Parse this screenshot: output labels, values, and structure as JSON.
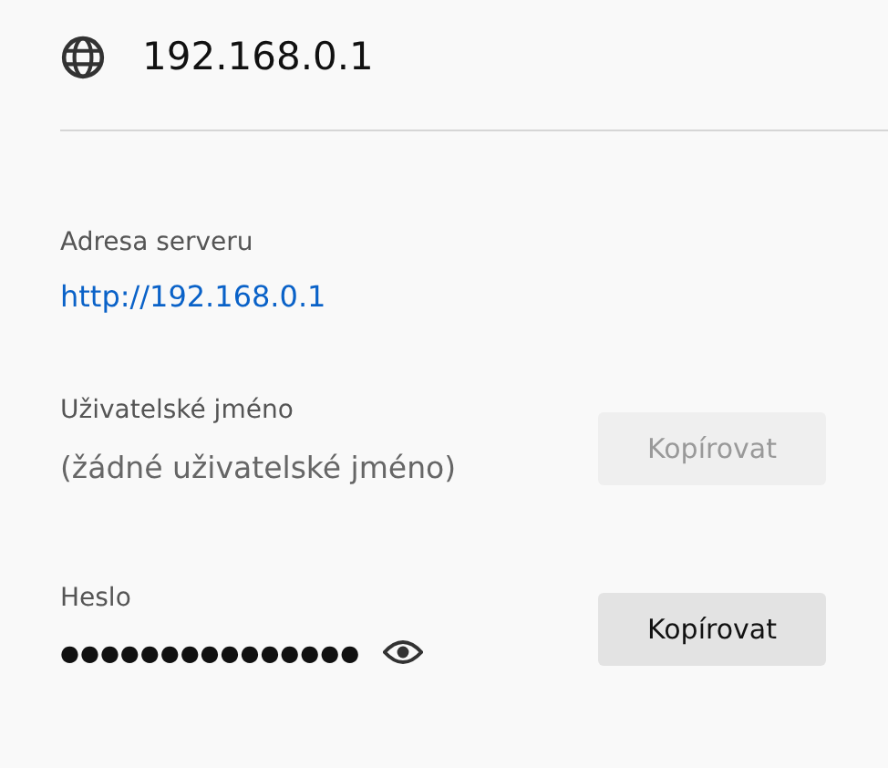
{
  "header": {
    "title": "192.168.0.1"
  },
  "server": {
    "label": "Adresa serveru",
    "link": "http://192.168.0.1"
  },
  "fields": [
    {
      "kind": "username",
      "label": "Uživatelské jméno",
      "value": "(žádné uživatelské jméno)",
      "button": {
        "label": "Kopírovat",
        "disabled": true
      }
    },
    {
      "kind": "password",
      "label": "Heslo",
      "value": "●●●●●●●●●●●●●●●",
      "button": {
        "label": "Kopírovat",
        "disabled": false
      }
    }
  ]
}
